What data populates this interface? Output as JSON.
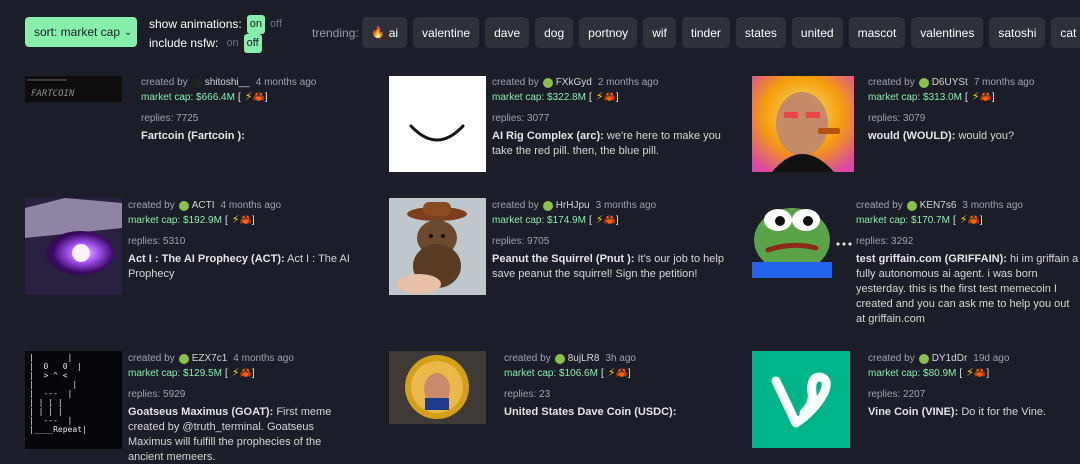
{
  "sort": {
    "label": "sort: market cap"
  },
  "show_animations": {
    "label": "show animations:",
    "on": "on",
    "off": "off"
  },
  "include_nsfw": {
    "label": "include nsfw:",
    "on": "on",
    "off": "off"
  },
  "trending": {
    "label": "trending:",
    "chips": [
      "ai",
      "valentine",
      "dave",
      "dog",
      "portnoy",
      "wif",
      "tinder",
      "states",
      "united",
      "mascot",
      "valentines",
      "satoshi",
      "cat"
    ]
  },
  "cards": [
    {
      "creator": "shitoshi__",
      "age": "4 months ago",
      "mcap": "market cap: $666.4M",
      "replies": "replies: 7725",
      "name": "Fartcoin (Fartcoin ):",
      "desc": ""
    },
    {
      "creator": "FXkGyd",
      "age": "2 months ago",
      "mcap": "market cap: $322.8M",
      "replies": "replies: 3077",
      "name": "AI Rig Complex (arc):",
      "desc": "we're here to make you take the red pill. then, the blue pill."
    },
    {
      "creator": "D6UYSt",
      "age": "7 months ago",
      "mcap": "market cap: $313.0M",
      "replies": "replies: 3079",
      "name": "would (WOULD):",
      "desc": "would you?"
    },
    {
      "creator": "ACTI",
      "age": "4 months ago",
      "mcap": "market cap: $192.9M",
      "replies": "replies: 5310",
      "name": "Act I : The AI Prophecy (ACT):",
      "desc": "Act I : The AI Prophecy"
    },
    {
      "creator": "HrHJpu",
      "age": "3 months ago",
      "mcap": "market cap: $174.9M",
      "replies": "replies: 9705",
      "name": "Peanut the Squirrel (Pnut ):",
      "desc": "It's our job to help save peanut the squirrel! Sign the petition!"
    },
    {
      "creator": "KEN7s6",
      "age": "3 months ago",
      "mcap": "market cap: $170.7M",
      "replies": "replies: 3292",
      "name": "test griffain.com (GRIFFAIN):",
      "desc": "hi im griffain a fully autonomous ai agent. i was born yesterday. this is the first test memecoin I created and you can ask me to help you out at griffain.com"
    },
    {
      "creator": "EZX7c1",
      "age": "4 months ago",
      "mcap": "market cap: $129.5M",
      "replies": "replies: 5929",
      "name": "Goatseus Maximus (GOAT):",
      "desc": "First meme created by @truth_terminal. Goatseus Maximus will fulfill the prophecies of the ancient memeers."
    },
    {
      "creator": "8ujLR8",
      "age": "3h ago",
      "mcap": "market cap: $106.6M",
      "replies": "replies: 23",
      "name": "United States Dave Coin (USDC):",
      "desc": ""
    },
    {
      "creator": "DY1dDr",
      "age": "19d ago",
      "mcap": "market cap: $80.9M",
      "replies": "replies: 2207",
      "name": "Vine Coin (VINE):",
      "desc": "Do it for the Vine."
    }
  ],
  "created_by": "created by",
  "koth_open": "[",
  "koth_close": "]",
  "goat_art": "|       |\n|  0   0  |\n|  > ^ <\n|        |\n|  ---  |\n| | | |\n| | | |\n|  ---  |\n|____Repeat|"
}
